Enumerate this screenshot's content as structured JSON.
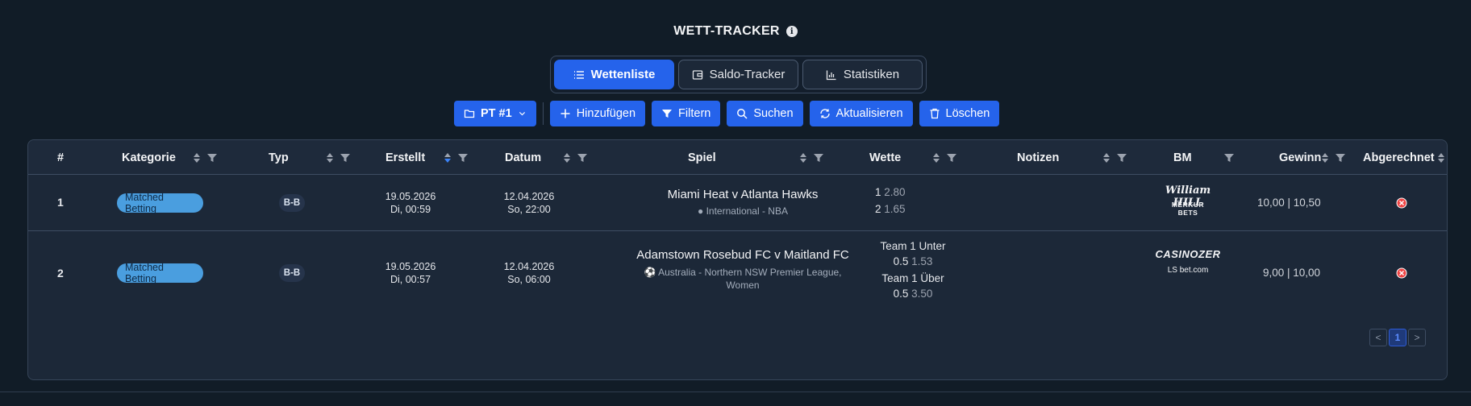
{
  "header": {
    "title": "WETT-TRACKER",
    "info_icon": "info-icon"
  },
  "tabs": [
    {
      "label": "Wettenliste",
      "icon": "list-icon",
      "active": true
    },
    {
      "label": "Saldo-Tracker",
      "icon": "wallet-icon",
      "active": false
    },
    {
      "label": "Statistiken",
      "icon": "bar-chart-icon",
      "active": false
    }
  ],
  "toolbar": {
    "profile_label": "PT #1",
    "add_label": "Hinzufügen",
    "filter_label": "Filtern",
    "search_label": "Suchen",
    "refresh_label": "Aktualisieren",
    "delete_label": "Löschen"
  },
  "table": {
    "columns": {
      "num": "#",
      "kategorie": "Kategorie",
      "typ": "Typ",
      "erstellt": "Erstellt",
      "datum": "Datum",
      "spiel": "Spiel",
      "wette": "Wette",
      "notizen": "Notizen",
      "bm": "BM",
      "gewinn": "Gewinn",
      "abgerechnet": "Abgerechnet"
    },
    "rows": [
      {
        "num": "1",
        "kategorie": "Matched Betting",
        "typ": "B-B",
        "erstellt_date": "19.05.2026",
        "erstellt_time": "Di, 00:59",
        "datum_date": "12.04.2026",
        "datum_time": "So, 22:00",
        "spiel": "Miami Heat v Atlanta Hawks",
        "league": "International - NBA",
        "wette": [
          {
            "sel": "1",
            "odd": "2.80"
          },
          {
            "sel": "2",
            "odd": "1.65"
          }
        ],
        "bm": [
          "William HILL",
          "MERKUR BETS"
        ],
        "gewinn": "10,00 | 10,50"
      },
      {
        "num": "2",
        "kategorie": "Matched Betting",
        "typ": "B-B",
        "erstellt_date": "19.05.2026",
        "erstellt_time": "Di, 00:57",
        "datum_date": "12.04.2026",
        "datum_time": "So, 06:00",
        "spiel": "Adamstown Rosebud FC v Maitland FC",
        "league_line1": "Australia - Northern NSW Premier League,",
        "league_line2": "Women",
        "wette": [
          {
            "label": "Team 1 Unter",
            "sel": "0.5",
            "odd": "1.53"
          },
          {
            "label": "Team 1 Über",
            "sel": "0.5",
            "odd": "3.50"
          }
        ],
        "bm": [
          "CASINOZER",
          "LS bet.com"
        ],
        "gewinn": "9,00 | 10,00"
      }
    ]
  },
  "pagination": {
    "prev": "<",
    "current": "1",
    "next": ">"
  },
  "colors": {
    "accent": "#2563eb",
    "background": "#111c27",
    "badge": "#4a9edf",
    "status_x": "#ef4444"
  }
}
